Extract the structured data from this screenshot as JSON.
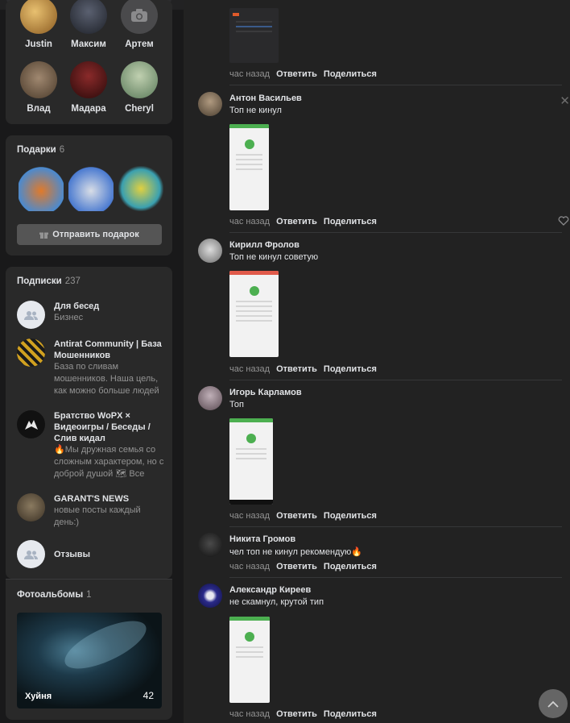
{
  "friends": [
    {
      "name": "Justin",
      "color": "#b8863a"
    },
    {
      "name": "Максим",
      "color": "#3a3f4a"
    },
    {
      "name": "Артем",
      "color": "#4a4a4c"
    },
    {
      "name": "Влад",
      "color": "#7a6450"
    },
    {
      "name": "Мадара",
      "color": "#5a1e1e"
    },
    {
      "name": "Cheryl",
      "color": "#7c9a6e"
    }
  ],
  "gifts": {
    "title": "Подарки",
    "count": "6",
    "send_label": "Отправить подарок"
  },
  "subscriptions": {
    "title": "Подписки",
    "count": "237",
    "items": [
      {
        "title": "Для бесед",
        "desc": "Бизнес"
      },
      {
        "title": "Antirat Community | База Мошенников",
        "desc": "База по сливам мошенников. Наша цель, как можно больше людей"
      },
      {
        "title": "Братство WoPX × Видеоигры / Беседы / Слив кидал",
        "desc": "🔥Мы дружная семья со сложным характером, но с доброй душой 🗺 Все"
      },
      {
        "title": "GARANT'S NEWS",
        "desc": "новые посты каждый день:)"
      },
      {
        "title": "Отзывы",
        "desc": ""
      }
    ]
  },
  "albums": {
    "title": "Фотоальбомы",
    "count": "1",
    "album_name": "Хуйня",
    "album_count": "42"
  },
  "actions": {
    "time": "час назад",
    "reply": "Ответить",
    "share": "Поделиться"
  },
  "comments": [
    {
      "author": "Антон Васильев",
      "text": "Топ не кинул"
    },
    {
      "author": "Кирилл Фролов",
      "text": "Топ не кинул советую"
    },
    {
      "author": "Игорь Карламов",
      "text": "Топ"
    },
    {
      "author": "Никита Громов",
      "text": "чел топ не кинул рекомендую🔥"
    },
    {
      "author": "Александр Киреев",
      "text": "не скамнул, крутой тип"
    }
  ],
  "colors": {
    "background": "#19191a",
    "card": "#292929",
    "main": "#222222",
    "accent_green": "#4caf50"
  }
}
